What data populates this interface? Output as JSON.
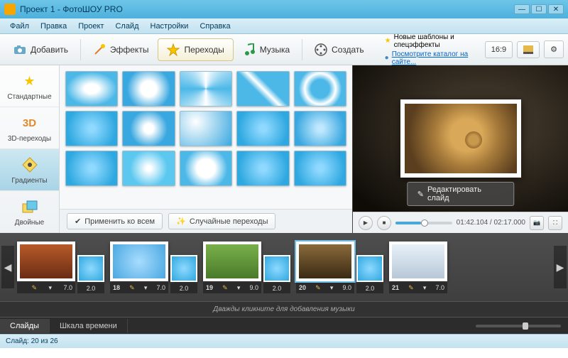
{
  "window": {
    "title": "Проект 1 - ФотоШОУ PRO"
  },
  "menu": [
    "Файл",
    "Правка",
    "Проект",
    "Слайд",
    "Настройки",
    "Справка"
  ],
  "toolbar": {
    "add": "Добавить",
    "effects": "Эффекты",
    "transitions": "Переходы",
    "music": "Музыка",
    "create": "Создать"
  },
  "info": {
    "news": "Новые шаблоны и спецэффекты",
    "link": "Посмотрите каталог на сайте..."
  },
  "aspect": "16:9",
  "sidebar": {
    "items": [
      {
        "label": "Стандартные",
        "icon": "star"
      },
      {
        "label": "3D-переходы",
        "icon": "3d"
      },
      {
        "label": "Градиенты",
        "icon": "grad"
      },
      {
        "label": "Двойные",
        "icon": "double"
      }
    ],
    "active_index": 2
  },
  "gallery_footer": {
    "apply_all": "Применить ко всем",
    "random": "Случайные переходы"
  },
  "preview": {
    "edit_label": "Редактировать слайд",
    "time_current": "01:42.104",
    "time_total": "02:17.000"
  },
  "timeline": {
    "slides": [
      {
        "num": "",
        "dur": "7.0",
        "trans": "2.0",
        "bg": "linear-gradient(#b85a2a,#6a2d14)"
      },
      {
        "num": "18",
        "dur": "7.0",
        "trans": "2.0",
        "bg": "radial-gradient(circle,#a8dcff,#4aa8e0)"
      },
      {
        "num": "19",
        "dur": "9.0",
        "trans": "2.0",
        "bg": "linear-gradient(#7ab04a,#4a7a2a)"
      },
      {
        "num": "20",
        "dur": "9.0",
        "trans": "2.0",
        "bg": "linear-gradient(#8a6a3a,#3a2a14)",
        "selected": true
      },
      {
        "num": "21",
        "dur": "7.0",
        "trans": "",
        "bg": "linear-gradient(#e8f0f8,#b8c8d8)"
      }
    ],
    "music_hint": "Дважды кликните для добавления музыки",
    "tabs": {
      "slides": "Слайды",
      "scale": "Шкала времени",
      "active": 0
    }
  },
  "status": "Слайд: 20 из 26"
}
